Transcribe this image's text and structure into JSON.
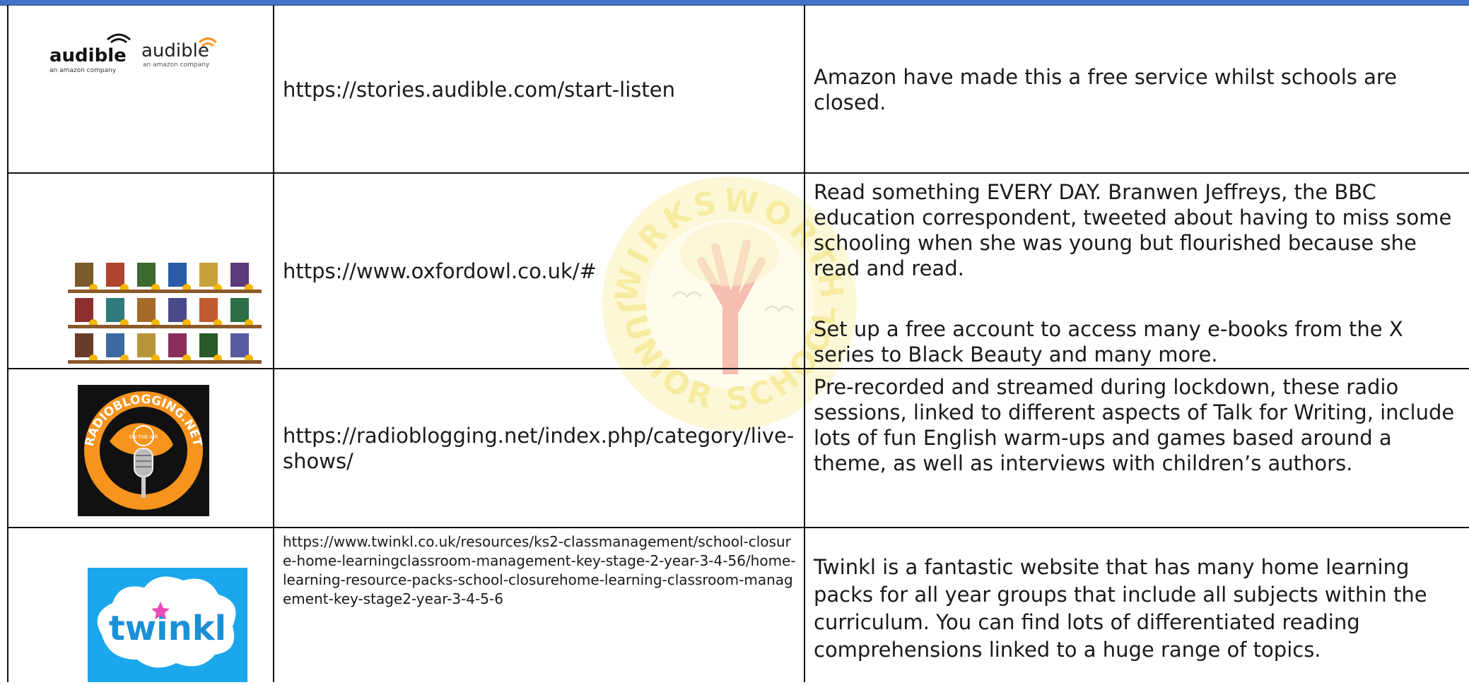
{
  "colors": {
    "header_bar": "#4472c4",
    "watermark_yellow": "#f5e06a",
    "tree_red": "#e8735a",
    "radio_orange": "#f7941d",
    "twinkl_blue": "#1aa7ec"
  },
  "watermark": {
    "text_top": "WIRKSWORTH",
    "text_bottom": "JUNIOR SCHOOL"
  },
  "rows": [
    {
      "logo": {
        "icon": "audible-logo-icon",
        "brand1": "audible",
        "sub1": "an amazon company",
        "brand2": "audible",
        "sub2": "an amazon company"
      },
      "url": "https://stories.audible.com/start-listen",
      "description": [
        "Amazon have made this a free service whilst schools are closed."
      ]
    },
    {
      "logo": {
        "icon": "bookshelf-icon"
      },
      "url": "https://www.oxfordowl.co.uk/#",
      "description": [
        "Read something EVERY DAY. Branwen Jeffreys, the BBC education correspondent, tweeted about having to miss some schooling when she was young but flourished because she read and read.",
        "Set up a free account to access many e-books from the X series to Black Beauty and many more."
      ]
    },
    {
      "logo": {
        "icon": "radio-microphone-icon",
        "text": "RADIOBLOGGING.NET",
        "badge": "ON THE AIR"
      },
      "url": "https://radioblogging.net/index.php/category/live-shows/",
      "description": [
        "Pre-recorded and streamed during lockdown, these radio sessions, linked to different aspects of Talk for Writing, include lots of fun English warm-ups and games based around a theme, as well as interviews with children’s authors."
      ]
    },
    {
      "logo": {
        "icon": "twinkl-logo-icon",
        "text": "twinkl"
      },
      "url": "https://www.twinkl.co.uk/resources/ks2-classmanagement/school-closure-home-learningclassroom-management-key-stage-2-year-3-4-56/home-learning-resource-packs-school-closurehome-learning-classroom-management-key-stage2-year-3-4-5-6",
      "description": [
        "Twinkl is a fantastic website that has many home learning packs for all year groups that include all subjects within the curriculum. You can find lots of differentiated reading comprehensions linked to a huge range of topics."
      ]
    }
  ]
}
